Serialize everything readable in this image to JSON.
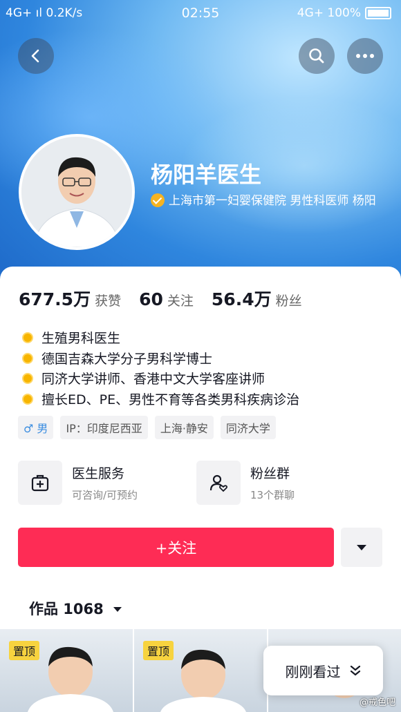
{
  "status_bar": {
    "left": "4G+ ıl 0.2K/s",
    "time": "02:55",
    "right": "4G+ 100%"
  },
  "profile": {
    "name": "杨阳羊医生",
    "verification": "上海市第一妇婴保健院 男性科医师 杨阳",
    "verify_color": "#f5b321"
  },
  "stats": [
    {
      "value": "677.5万",
      "label": "获赞"
    },
    {
      "value": "60",
      "label": "关注"
    },
    {
      "value": "56.4万",
      "label": "粉丝"
    }
  ],
  "bio": [
    "生殖男科医生",
    "德国吉森大学分子男科学博士",
    "同济大学讲师、香港中文大学客座讲师",
    "擅长ED、PE、男性不育等各类男科疾病诊治"
  ],
  "tags": [
    "♂ 男",
    "IP：印度尼西亚",
    "上海·静安",
    "同济大学"
  ],
  "services": [
    {
      "title": "医生服务",
      "subtitle": "可咨询/可预约",
      "icon": "medical-kit-icon"
    },
    {
      "title": "粉丝群",
      "subtitle": "13个群聊",
      "icon": "user-heart-icon"
    }
  ],
  "actions": {
    "follow_label": "+关注",
    "follow_color": "#fe2c55"
  },
  "works": {
    "label": "作品 1068"
  },
  "thumbs": [
    {
      "badge": "置顶"
    },
    {
      "badge": "置顶"
    },
    {
      "badge": ""
    }
  ],
  "recent_label": "刚刚看过",
  "watermark": "@戒色吧"
}
